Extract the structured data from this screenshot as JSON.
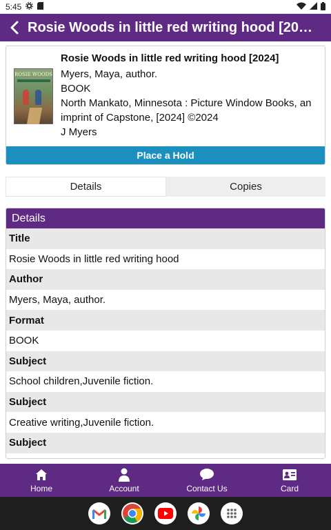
{
  "status_bar": {
    "time": "5:45"
  },
  "app_bar": {
    "title": "Rosie Woods in little red writing hood [2024]"
  },
  "book": {
    "title": "Rosie Woods in little red writing hood [2024]",
    "author": "Myers, Maya, author.",
    "format": "BOOK",
    "publisher": "North Mankato, Minnesota : Picture Window Books, an imprint of Capstone, [2024] ©2024",
    "call_number": "J Myers",
    "cover_text": "ROSIE WOODS",
    "hold_button": "Place a Hold"
  },
  "tabs": [
    {
      "label": "Details",
      "active": true
    },
    {
      "label": "Copies",
      "active": false
    }
  ],
  "details": {
    "header": "Details",
    "rows": [
      {
        "label": "Title",
        "value": "Rosie Woods in little red writing hood"
      },
      {
        "label": "Author",
        "value": "Myers, Maya, author."
      },
      {
        "label": "Format",
        "value": "BOOK"
      },
      {
        "label": "Subject",
        "value": "School children,Juvenile fiction."
      },
      {
        "label": "Subject",
        "value": "Creative writing,Juvenile fiction."
      },
      {
        "label": "Subject",
        "value": ""
      }
    ]
  },
  "bottom_nav": [
    {
      "label": "Home",
      "icon": "home-icon"
    },
    {
      "label": "Account",
      "icon": "account-icon"
    },
    {
      "label": "Contact Us",
      "icon": "chat-icon"
    },
    {
      "label": "Card",
      "icon": "card-icon"
    }
  ],
  "dock_apps": [
    "gmail-icon",
    "chrome-icon",
    "youtube-icon",
    "photos-icon",
    "app-drawer-icon"
  ],
  "colors": {
    "primary": "#5e2a84",
    "hold_button": "#1b8fbd",
    "label_row": "#e8e8e8"
  }
}
